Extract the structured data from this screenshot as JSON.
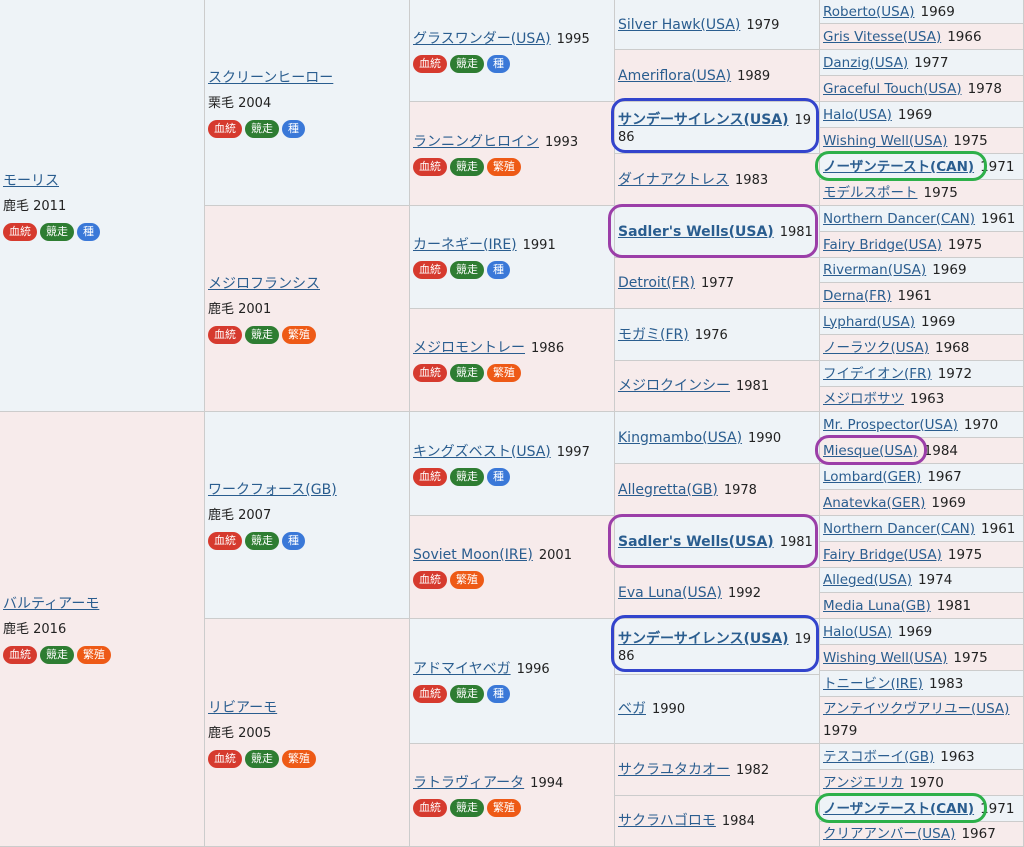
{
  "gen1": [
    {
      "name": "モーリス",
      "info": "鹿毛 2011",
      "tags": [
        "血統",
        "競走",
        "種"
      ]
    },
    {
      "name": "バルティアーモ",
      "info": "鹿毛 2016",
      "tags": [
        "血統",
        "競走",
        "繁殖"
      ]
    }
  ],
  "gen2": [
    {
      "name": "スクリーンヒーロー",
      "info": "栗毛 2004",
      "tags": [
        "血統",
        "競走",
        "種"
      ]
    },
    {
      "name": "メジロフランシス",
      "info": "鹿毛 2001",
      "tags": [
        "血統",
        "競走",
        "繁殖"
      ]
    },
    {
      "name": "ワークフォース(GB)",
      "info": "鹿毛 2007",
      "tags": [
        "血統",
        "競走",
        "種"
      ]
    },
    {
      "name": "リビアーモ",
      "info": "鹿毛 2005",
      "tags": [
        "血統",
        "競走",
        "繁殖"
      ]
    }
  ],
  "gen3": [
    {
      "name": "グラスワンダー(USA)",
      "year": "1995",
      "tags": [
        "血統",
        "競走",
        "種"
      ]
    },
    {
      "name": "ランニングヒロイン",
      "year": "1993",
      "tags": [
        "血統",
        "競走",
        "繁殖"
      ]
    },
    {
      "name": "カーネギー(IRE)",
      "year": "1991",
      "tags": [
        "血統",
        "競走",
        "種"
      ]
    },
    {
      "name": "メジロモントレー",
      "year": "1986",
      "tags": [
        "血統",
        "競走",
        "繁殖"
      ]
    },
    {
      "name": "キングズベスト(USA)",
      "year": "1997",
      "tags": [
        "血統",
        "競走",
        "種"
      ]
    },
    {
      "name": "Soviet Moon(IRE)",
      "year": "2001",
      "tags": [
        "血統",
        "繁殖"
      ]
    },
    {
      "name": "アドマイヤベガ",
      "year": "1996",
      "tags": [
        "血統",
        "競走",
        "種"
      ]
    },
    {
      "name": "ラトラヴィアータ",
      "year": "1994",
      "tags": [
        "血統",
        "競走",
        "繁殖"
      ]
    }
  ],
  "gen4": [
    {
      "name": "Silver Hawk(USA)",
      "year": "1979"
    },
    {
      "name": "Ameriflora(USA)",
      "year": "1989"
    },
    {
      "name": "サンデーサイレンス(USA)",
      "year": "19",
      "year2": "86"
    },
    {
      "name": "ダイナアクトレス",
      "year": "1983"
    },
    {
      "name": "Sadler's Wells(USA)",
      "year": "1981"
    },
    {
      "name": "Detroit(FR)",
      "year": "1977"
    },
    {
      "name": "モガミ(FR)",
      "year": "1976"
    },
    {
      "name": "メジロクインシー",
      "year": "1981"
    },
    {
      "name": "Kingmambo(USA)",
      "year": "1990"
    },
    {
      "name": "Allegretta(GB)",
      "year": "1978"
    },
    {
      "name": "Sadler's Wells(USA)",
      "year": "1981"
    },
    {
      "name": "Eva Luna(USA)",
      "year": "1992"
    },
    {
      "name": "サンデーサイレンス(USA)",
      "year": "19",
      "year2": "86"
    },
    {
      "name": "ベガ",
      "year": "1990"
    },
    {
      "name": "サクラユタカオー",
      "year": "1982"
    },
    {
      "name": "サクラハゴロモ",
      "year": "1984"
    }
  ],
  "gen5": [
    {
      "name": "Roberto(USA)",
      "year": "1969"
    },
    {
      "name": "Gris Vitesse(USA)",
      "year": "1966"
    },
    {
      "name": "Danzig(USA)",
      "year": "1977"
    },
    {
      "name": "Graceful Touch(USA)",
      "year": "1978"
    },
    {
      "name": "Halo(USA)",
      "year": "1969"
    },
    {
      "name": "Wishing Well(USA)",
      "year": "1975"
    },
    {
      "name": "ノーザンテースト(CAN)",
      "year": "1971"
    },
    {
      "name": "モデルスポート",
      "year": "1975"
    },
    {
      "name": "Northern Dancer(CAN)",
      "year": "1961"
    },
    {
      "name": "Fairy Bridge(USA)",
      "year": "1975"
    },
    {
      "name": "Riverman(USA)",
      "year": "1969"
    },
    {
      "name": "Derna(FR)",
      "year": "1961"
    },
    {
      "name": "Lyphard(USA)",
      "year": "1969"
    },
    {
      "name": "ノーラツク(USA)",
      "year": "1968"
    },
    {
      "name": "フイデイオン(FR)",
      "year": "1972"
    },
    {
      "name": "メジロボサツ",
      "year": "1963"
    },
    {
      "name": "Mr. Prospector(USA)",
      "year": "1970"
    },
    {
      "name": "Miesque(USA)",
      "year": "1984"
    },
    {
      "name": "Lombard(GER)",
      "year": "1967"
    },
    {
      "name": "Anatevka(GER)",
      "year": "1969"
    },
    {
      "name": "Northern Dancer(CAN)",
      "year": "1961"
    },
    {
      "name": "Fairy Bridge(USA)",
      "year": "1975"
    },
    {
      "name": "Alleged(USA)",
      "year": "1974"
    },
    {
      "name": "Media Luna(GB)",
      "year": "1981"
    },
    {
      "name": "Halo(USA)",
      "year": "1969"
    },
    {
      "name": "Wishing Well(USA)",
      "year": "1975"
    },
    {
      "name": "トニービン(IRE)",
      "year": "1983"
    },
    {
      "name": "アンテイツクヴアリユー(USA)",
      "year": "1979"
    },
    {
      "name": "テスコボーイ(GB)",
      "year": "1963"
    },
    {
      "name": "アンジエリカ",
      "year": "1970"
    },
    {
      "name": "ノーザンテースト(CAN)",
      "year": "1971"
    },
    {
      "name": "クリアアンバー(USA)",
      "year": "1967"
    }
  ],
  "colors": {
    "blood": "#d63a2e",
    "race": "#2e7d32",
    "stud": "#3a78d8",
    "broodmare": "#ee5a16",
    "sire_bg": "#eef3f7",
    "dam_bg": "#f7ebeb",
    "link": "#2a5d8f"
  }
}
